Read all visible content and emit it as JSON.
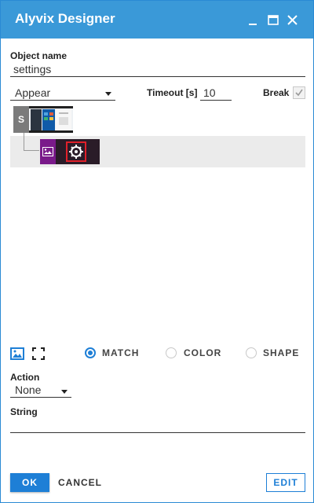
{
  "window": {
    "title": "Alyvix Designer",
    "accent": "#3a99d8",
    "controls": [
      "minimize-icon",
      "maximize-icon",
      "close-icon"
    ]
  },
  "object": {
    "name_label": "Object name",
    "name_value": "settings"
  },
  "options": {
    "mode_value": "Appear",
    "timeout_label": "Timeout [s]",
    "timeout_value": "10",
    "break_label": "Break",
    "break_checked": true
  },
  "tree": {
    "root_badge": "S"
  },
  "detection": {
    "icons": [
      "image-icon",
      "fullscreen-icon"
    ],
    "modes": [
      {
        "label": "MATCH",
        "selected": true
      },
      {
        "label": "COLOR",
        "selected": false
      },
      {
        "label": "SHAPE",
        "selected": false
      }
    ]
  },
  "action": {
    "label": "Action",
    "value": "None"
  },
  "string": {
    "label": "String",
    "value": ""
  },
  "buttons": {
    "ok": "OK",
    "cancel": "CANCEL",
    "edit": "EDIT"
  }
}
